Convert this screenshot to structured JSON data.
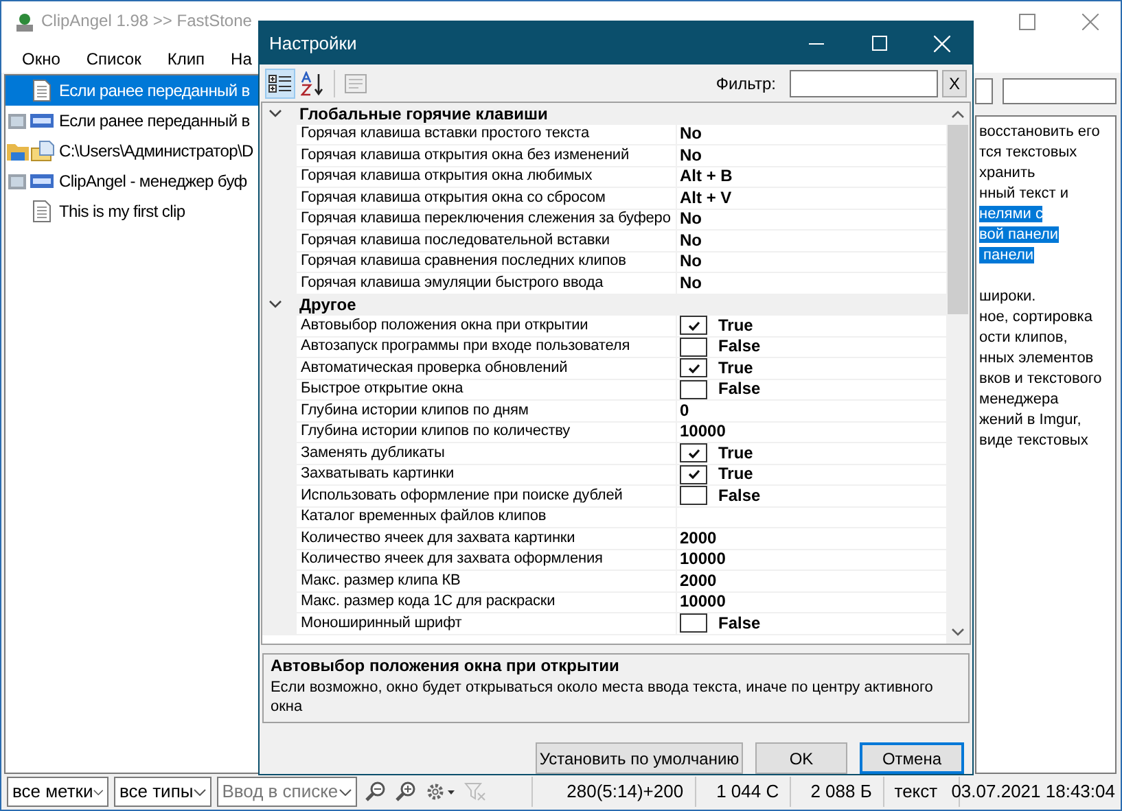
{
  "main_window": {
    "title": "ClipAngel 1.98 >> FastStone",
    "menu": [
      "Окно",
      "Список",
      "Клип",
      "На"
    ],
    "clips": [
      {
        "text": "Если ранее переданный в",
        "kind": "text",
        "selected": true
      },
      {
        "text": "Если ранее переданный в",
        "kind": "html",
        "selected": false
      },
      {
        "text": "C:\\Users\\Администратор\\D",
        "kind": "file",
        "selected": false
      },
      {
        "text": "ClipAngel - менеджер буф",
        "kind": "html",
        "selected": false
      },
      {
        "text": "This is my first clip",
        "kind": "text",
        "selected": false
      }
    ],
    "preview_paragraphs": [
      {
        "lines": [
          {
            "text": "восстановить его",
            "selected": false
          },
          {
            "text": "тся текстовых",
            "selected": false
          },
          {
            "text": "хранить",
            "selected": false
          },
          {
            "text": "нный текст и",
            "selected": false
          },
          {
            "text": "нелями с",
            "selected": true
          },
          {
            "text": "вой панели",
            "selected": true
          },
          {
            "text": " панели",
            "selected": true
          }
        ]
      },
      {
        "lines": [
          {
            "text": "широки.",
            "selected": false
          },
          {
            "text": "ное, сортировка",
            "selected": false
          },
          {
            "text": "ости клипов,",
            "selected": false
          },
          {
            "text": "нных элементов",
            "selected": false
          },
          {
            "text": "вков и текстового",
            "selected": false
          },
          {
            "text": "менеджера",
            "selected": false
          },
          {
            "text": "жений в Imgur,",
            "selected": false
          },
          {
            "text": "виде текстовых",
            "selected": false
          }
        ]
      }
    ],
    "status_bar": {
      "mark_filter": "все метки",
      "type_filter": "все типы",
      "search_placeholder": "Ввод в списке",
      "fields": [
        "280(5:14)+200",
        "1 044 C",
        "2 088 Б",
        "текст",
        "03.07.2021 18:43:04"
      ]
    }
  },
  "dialog": {
    "title": "Настройки",
    "view_buttons": [
      {
        "kind": "categorized",
        "selected": true
      },
      {
        "kind": "alphabetical",
        "selected": false
      },
      {
        "kind": "pages",
        "selected": false
      }
    ],
    "filter_label": "Фильтр:",
    "filter_clear": "X",
    "categories": [
      {
        "name": "Глобальные горячие клавиши",
        "expanded": true,
        "properties": [
          {
            "name": "Горячая клавиша вставки простого текста",
            "kind": "text",
            "value": "No"
          },
          {
            "name": "Горячая клавиша открытия окна без изменений",
            "kind": "text",
            "value": "No"
          },
          {
            "name": "Горячая клавиша открытия окна любимых",
            "kind": "text",
            "value": "Alt + B"
          },
          {
            "name": "Горячая клавиша открытия окна со сбросом",
            "kind": "text",
            "value": "Alt + V"
          },
          {
            "name": "Горячая клавиша переключения слежения за буферо",
            "kind": "text",
            "value": "No"
          },
          {
            "name": "Горячая клавиша последовательной вставки",
            "kind": "text",
            "value": "No"
          },
          {
            "name": "Горячая клавиша сравнения последних клипов",
            "kind": "text",
            "value": "No"
          },
          {
            "name": "Горячая клавиша эмуляции быстрого ввода",
            "kind": "text",
            "value": "No"
          }
        ]
      },
      {
        "name": "Другое",
        "expanded": true,
        "properties": [
          {
            "name": "Автовыбор положения окна при открытии",
            "kind": "bool",
            "checked": true,
            "value": "True"
          },
          {
            "name": "Автозапуск программы при входе пользователя",
            "kind": "bool",
            "checked": false,
            "value": "False"
          },
          {
            "name": "Автоматическая проверка обновлений",
            "kind": "bool",
            "checked": true,
            "value": "True"
          },
          {
            "name": "Быстрое открытие окна",
            "kind": "bool",
            "checked": false,
            "value": "False"
          },
          {
            "name": "Глубина истории клипов по дням",
            "kind": "text",
            "value": "0"
          },
          {
            "name": "Глубина истории клипов по количеству",
            "kind": "text",
            "value": "10000"
          },
          {
            "name": "Заменять дубликаты",
            "kind": "bool",
            "checked": true,
            "value": "True"
          },
          {
            "name": "Захватывать картинки",
            "kind": "bool",
            "checked": true,
            "value": "True"
          },
          {
            "name": "Использовать оформление при поиске дублей",
            "kind": "bool",
            "checked": false,
            "value": "False"
          },
          {
            "name": "Каталог временных файлов клипов",
            "kind": "text"
          },
          {
            "name": "Количество ячеек для захвата картинки",
            "kind": "text",
            "value": "2000"
          },
          {
            "name": "Количество ячеек для захвата оформления",
            "kind": "text",
            "value": "10000"
          },
          {
            "name": "Макс. размер  клипа КВ",
            "kind": "text",
            "value": "2000"
          },
          {
            "name": "Макс. размер кода 1С для раскраски",
            "kind": "text",
            "value": "10000"
          },
          {
            "name": "Моноширинный шрифт",
            "kind": "bool",
            "checked": false,
            "value": "False"
          }
        ]
      }
    ],
    "description": {
      "title": "Автовыбор положения окна при открытии",
      "text": "Если возможно, окно будет открываться около места ввода текста, иначе по центру активного окна"
    },
    "buttons": [
      {
        "label": "Установить по умолчанию",
        "default": false
      },
      {
        "label": "OK",
        "default": false
      },
      {
        "label": "Отмена",
        "default": true
      }
    ]
  }
}
